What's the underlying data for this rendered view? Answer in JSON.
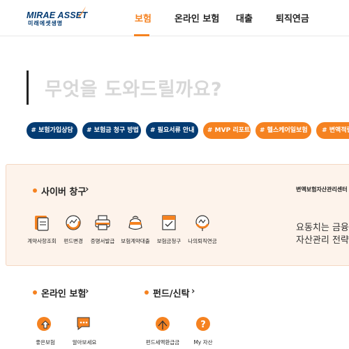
{
  "header": {
    "logo_main": "MIRAE ASSET",
    "logo_sub": "미래에셋생명",
    "nav": [
      {
        "label": "보험",
        "active": true
      },
      {
        "label": "온라인 보험",
        "active": false
      },
      {
        "label": "대출",
        "active": false
      },
      {
        "label": "퇴직연금",
        "active": false
      }
    ]
  },
  "search": {
    "placeholder": "무엇을 도와드릴까요?"
  },
  "tags": [
    {
      "label": "# 보험가입상담",
      "color": "blue"
    },
    {
      "label": "# 보험금 청구 방법",
      "color": "blue"
    },
    {
      "label": "# 필요서류 안내",
      "color": "blue"
    },
    {
      "label": "# MVP 리포트",
      "color": "orange"
    },
    {
      "label": "# 헬스케어일보험",
      "color": "orange"
    },
    {
      "label": "# 변액적립",
      "color": "orange"
    }
  ],
  "cyber": {
    "title": "사이버 창구",
    "items": [
      {
        "label": "계약사항조회",
        "icon": "document-icon"
      },
      {
        "label": "펀드변경",
        "icon": "fund-change-icon"
      },
      {
        "label": "증명서발급",
        "icon": "printer-icon"
      },
      {
        "label": "보험계약대출",
        "icon": "money-bag-icon"
      },
      {
        "label": "보험금청구",
        "icon": "claim-icon"
      },
      {
        "label": "나의퇴직연금",
        "icon": "pension-icon"
      }
    ],
    "right_title": "변액보험자산관리센터",
    "right_lines": [
      "요동치는 금융시",
      "자산관리 전략은"
    ]
  },
  "online": {
    "title": "온라인 보험",
    "items": [
      {
        "label": "좋은보험",
        "icon": "good-insurance-icon"
      },
      {
        "label": "알아보세요",
        "icon": "chat-icon"
      }
    ]
  },
  "fund": {
    "title": "펀드/신탁",
    "items": [
      {
        "label": "펀드세액환급금",
        "icon": "fund-refund-icon"
      },
      {
        "label": "My 자산",
        "icon": "my-asset-icon"
      }
    ]
  },
  "colors": {
    "accent": "#f58220",
    "brand": "#043b72",
    "panel_bg": "#fdf3eb"
  }
}
